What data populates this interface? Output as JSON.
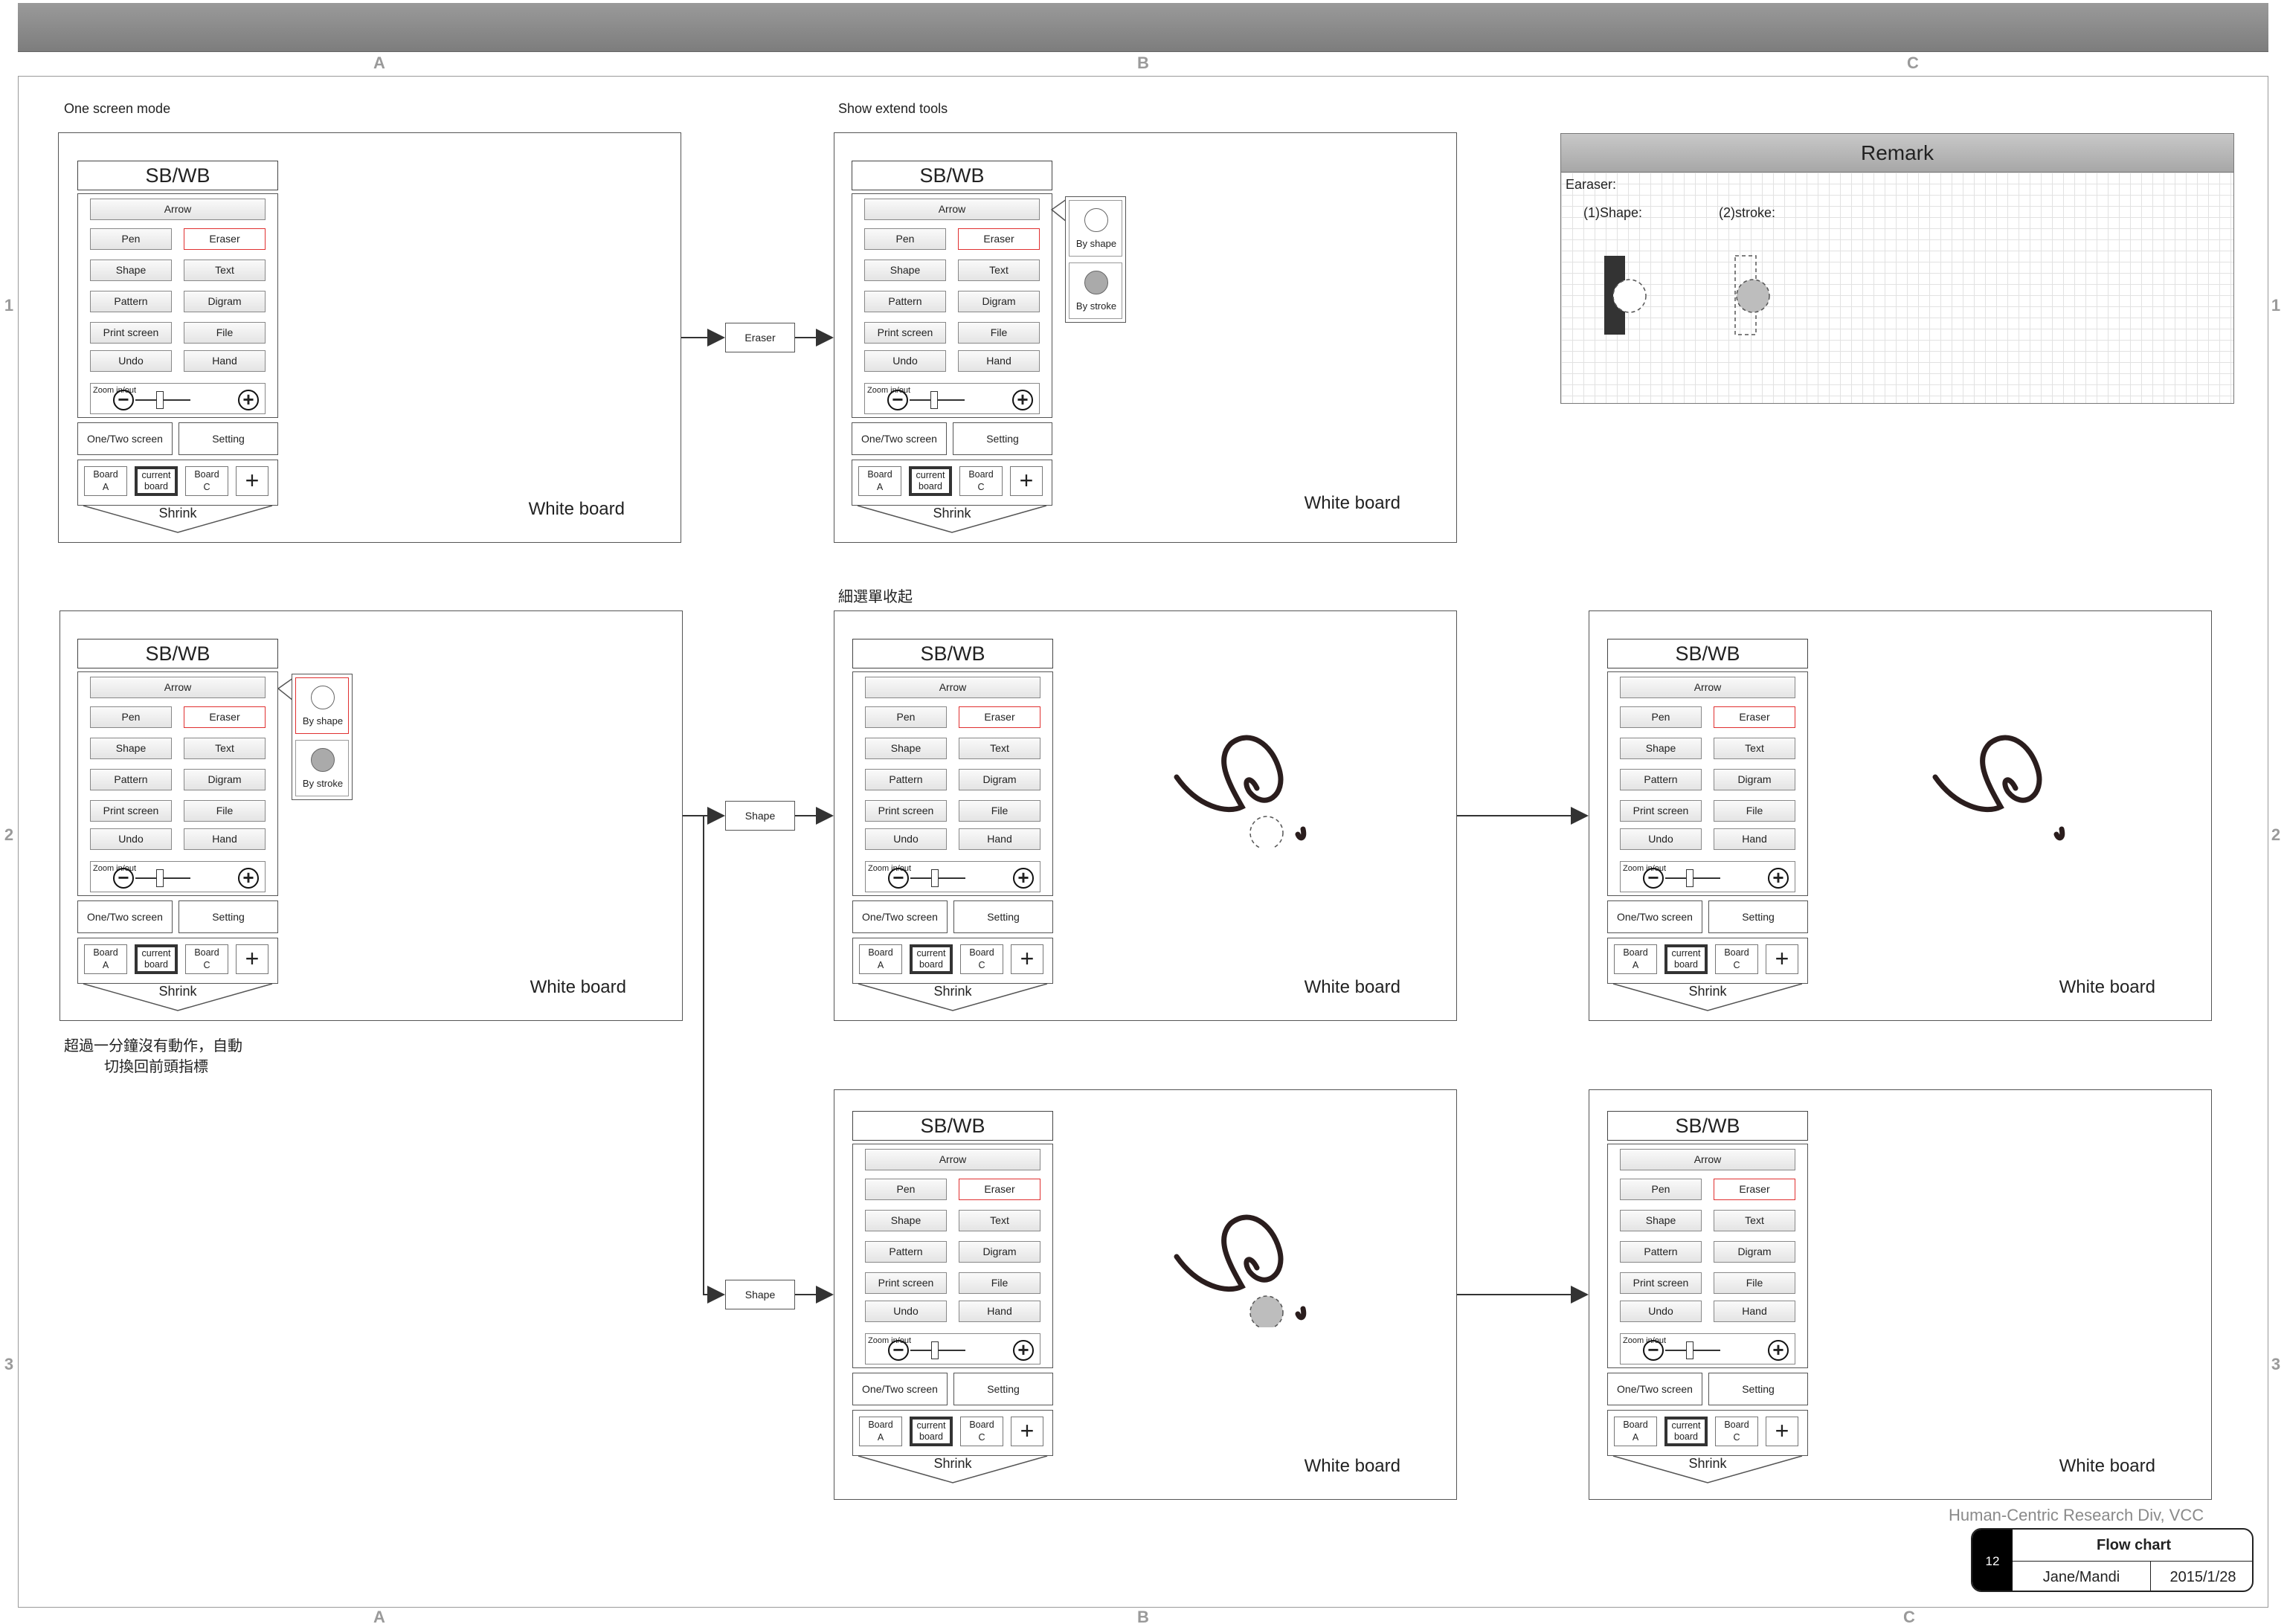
{
  "columns": [
    "A",
    "B",
    "C"
  ],
  "rows": [
    "1",
    "2",
    "3"
  ],
  "labels": {
    "one_screen_mode": "One  screen mode",
    "show_extend_tools": "Show extend tools",
    "submenu_collapse": "細選單收起",
    "auto_switch_1": "超過一分鐘沒有動作，自動",
    "auto_switch_2": "切換回前頭指標"
  },
  "toolbar": {
    "title": "SB/WB",
    "arrow": "Arrow",
    "pen": "Pen",
    "eraser": "Eraser",
    "shape": "Shape",
    "text": "Text",
    "pattern": "Pattern",
    "digram": "Digram",
    "print_screen": "Print screen",
    "file": "File",
    "undo": "Undo",
    "hand": "Hand",
    "zoom": "Zoom in/out",
    "minus": "−",
    "plus": "+",
    "one_two_screen": "One/Two screen",
    "setting": "Setting",
    "board_a_1": "Board",
    "board_a_2": "A",
    "current_1": "current",
    "current_2": "board",
    "board_c_1": "Board",
    "board_c_2": "C",
    "add": "+",
    "shrink": "Shrink"
  },
  "submenu": {
    "by_shape": "By shape",
    "by_stroke": "By stroke"
  },
  "whiteboard": "White board",
  "flow_labels": {
    "eraser": "Eraser",
    "shape": "Shape"
  },
  "remark": {
    "title": "Remark",
    "eraser": "Earaser:",
    "shape": "(1)Shape:",
    "stroke": "(2)stroke:"
  },
  "footer": {
    "company": "Human-Centric Research Div, VCC",
    "page": "12",
    "title": "Flow chart",
    "author": "Jane/Mandi",
    "date": "2015/1/28"
  }
}
